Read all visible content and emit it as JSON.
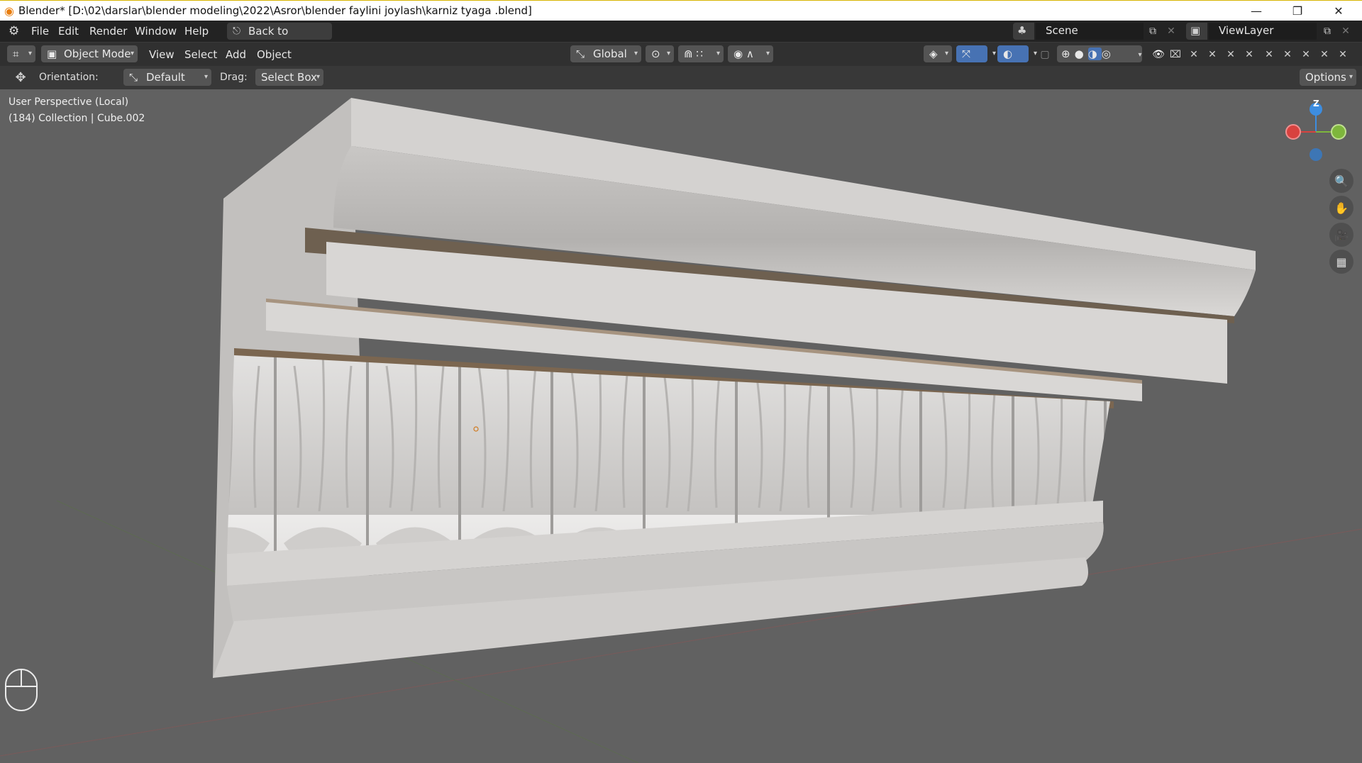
{
  "window": {
    "title": "Blender* [D:\\02\\darslar\\blender modeling\\2022\\Asror\\blender faylini joylash\\karniz tyaga .blend]",
    "minimize": "—",
    "restore": "❐",
    "close": "✕"
  },
  "topbar": {
    "menus": [
      "File",
      "Edit",
      "Render",
      "Window",
      "Help"
    ],
    "back_button": "Back to Previous",
    "scene": "Scene",
    "view_layer": "ViewLayer"
  },
  "header": {
    "mode": "Object Mode",
    "menus": [
      "View",
      "Select",
      "Add",
      "Object"
    ],
    "transform_orientation": "Global"
  },
  "tool_settings": {
    "orientation_label": "Orientation:",
    "orientation_value": "Default",
    "drag_label": "Drag:",
    "drag_value": "Select Box",
    "options": "Options"
  },
  "viewport": {
    "perspective_text": "User Perspective (Local)",
    "collection_text": "(184) Collection | Cube.002",
    "gizmo_z": "Z",
    "axis_colors": {
      "x": "#d8423f",
      "y": "#7eb63c",
      "z": "#3d8de0"
    }
  },
  "icons": [
    "blender-logo-icon",
    "editor-type-icon",
    "transform-gizmo-icon",
    "snap-icon",
    "proportional-edit-icon",
    "overlay-icon",
    "gizmo-icon",
    "shading-wireframe-icon",
    "shading-solid-icon",
    "shading-material-icon",
    "shading-rendered-icon",
    "zoom-icon",
    "pan-hand-icon",
    "camera-icon",
    "grid-icon",
    "mouse-icon"
  ]
}
